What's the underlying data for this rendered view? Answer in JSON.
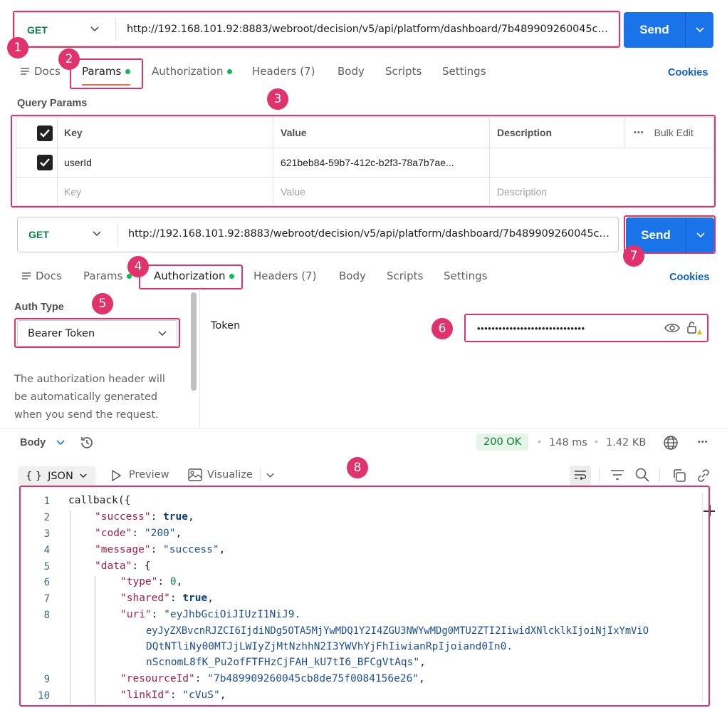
{
  "request1": {
    "method": "GET",
    "url": "http://192.168.101.92:8883/webroot/decision/v5/api/platform/dashboard/7b489909260045cb...",
    "send_label": "Send",
    "tabs": {
      "docs": "Docs",
      "params": "Params",
      "authorization": "Authorization",
      "headers": "Headers (7)",
      "body": "Body",
      "scripts": "Scripts",
      "settings": "Settings"
    },
    "cookies": "Cookies"
  },
  "query_params": {
    "title": "Query Params",
    "headers": {
      "key": "Key",
      "value": "Value",
      "description": "Description",
      "bulk_edit": "Bulk Edit"
    },
    "rows": [
      {
        "key": "userId",
        "value": "621beb84-59b7-412c-b2f3-78a7b7ae...",
        "description": ""
      }
    ],
    "placeholders": {
      "key": "Key",
      "value": "Value",
      "description": "Description"
    }
  },
  "request2": {
    "method": "GET",
    "url": "http://192.168.101.92:8883/webroot/decision/v5/api/platform/dashboard/7b489909260045cb...",
    "send_label": "Send",
    "tabs": {
      "docs": "Docs",
      "params": "Params",
      "authorization": "Authorization",
      "headers": "Headers (7)",
      "body": "Body",
      "scripts": "Scripts",
      "settings": "Settings"
    },
    "cookies": "Cookies"
  },
  "auth": {
    "type_label": "Auth Type",
    "type_value": "Bearer Token",
    "help_line1": "The authorization header will",
    "help_line2": "be automatically generated",
    "help_line3": "when you send the request.",
    "token_label": "Token",
    "token_masked": "••••••••••••••••••••••••••••••"
  },
  "response": {
    "body_label": "Body",
    "status": "200 OK",
    "time": "148 ms",
    "size": "1.42 KB",
    "format": "JSON",
    "preview": "Preview",
    "visualize": "Visualize",
    "lines": [
      {
        "n": "1"
      },
      {
        "n": "2"
      },
      {
        "n": "3"
      },
      {
        "n": "4"
      },
      {
        "n": "5"
      },
      {
        "n": "6"
      },
      {
        "n": "7"
      },
      {
        "n": "8"
      },
      {
        "n": "9"
      },
      {
        "n": "10"
      }
    ],
    "code": {
      "l1": "callback({",
      "k_success": "\"success\"",
      "v_success": "true",
      "k_code": "\"code\"",
      "v_code": "\"200\"",
      "k_message": "\"message\"",
      "v_message": "\"success\"",
      "k_data": "\"data\"",
      "k_type": "\"type\"",
      "v_type": "0",
      "k_shared": "\"shared\"",
      "v_shared": "true",
      "k_uri": "\"uri\"",
      "uri_1": "\"eyJhbGciOiJIUzI1NiJ9.",
      "uri_2": "eyJyZXBvcnRJZCI6IjdiNDg5OTA5MjYwMDQ1Y2I4ZGU3NWYwMDg0MTU2ZTI2IiwidXNlcklkIjoiNjIxYmViO",
      "uri_3": "DQtNTliNy00MTJjLWIyZjMtNzhhN2I3YWVhYjFhIiwianRpIjoiand0In0.",
      "uri_4": "nScnomL8fK_Pu2ofFTFHzCjFAH_kU7tI6_BFCgVtAqs\"",
      "k_resourceId": "\"resourceId\"",
      "v_resourceId": "\"7b489909260045cb8de75f0084156e26\"",
      "k_linkId": "\"linkId\"",
      "v_linkId": "\"cVuS\""
    }
  },
  "badges": [
    "1",
    "2",
    "3",
    "4",
    "5",
    "6",
    "7",
    "8"
  ]
}
